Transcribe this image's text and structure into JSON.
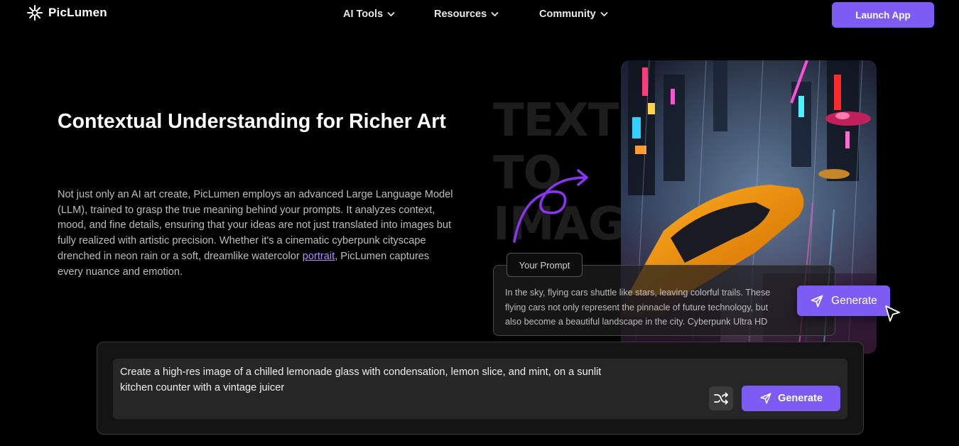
{
  "header": {
    "logo_text": "PicLumen",
    "logo_icon": "sparkle-burst-icon",
    "nav": [
      {
        "label": "AI Tools",
        "icon": "chevron-down-icon"
      },
      {
        "label": "Resources",
        "icon": "chevron-down-icon"
      },
      {
        "label": "Community",
        "icon": "chevron-down-icon"
      }
    ],
    "launch_label": "Launch App"
  },
  "main": {
    "heading": "Contextual Understanding for Richer Art",
    "description_before_link": "Not just only an AI art create, PicLumen employs an advanced Large Language Model (LLM), trained to grasp the true meaning behind your prompts. It analyzes context, mood, and fine details, ensuring that your ideas are not just translated into images but fully realized with artistic precision. Whether it's a cinematic cyberpunk cityscape drenched in neon rain or a soft, dreamlike watercolor ",
    "description_link": "portrait",
    "description_after_link": ", PicLumen captures every nuance and emotion."
  },
  "visual": {
    "background_words": [
      "TEXT",
      "TO",
      "IMAGE"
    ],
    "prompt_label": "Your Prompt",
    "prompt_lines": [
      "In the sky, flying cars shuttle like stars, leaving colorful trails. These",
      "flying cars not only represent the pinnacle of future technology, but",
      "also become a beautiful landscape in the city. Cyberpunk Ultra HD"
    ],
    "generate_label": "Generate"
  },
  "prompt_panel": {
    "text_lines": [
      "Create a high-res image of a chilled lemonade glass with condensation, lemon slice, and mint, on a sunlit",
      "kitchen counter with a vintage juicer"
    ],
    "shuffle_icon": "shuffle-icon",
    "generate_label": "Generate",
    "generate_icon": "send-icon"
  },
  "colors": {
    "accent": "#7c5cf2",
    "link": "#b08cff",
    "background": "#000000",
    "panel": "#141414"
  }
}
